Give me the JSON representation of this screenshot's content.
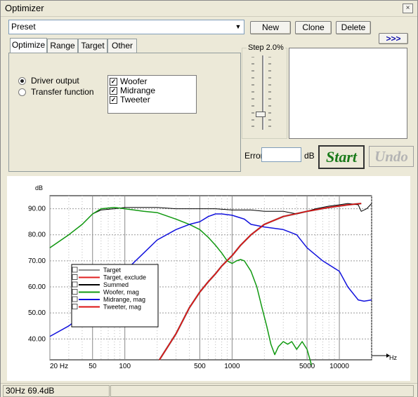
{
  "window": {
    "title": "Optimizer",
    "close_label": "×"
  },
  "preset": {
    "value": "Preset"
  },
  "buttons": {
    "new": "New",
    "clone": "Clone",
    "delete": "Delete",
    "more": ">>>"
  },
  "tabs": [
    {
      "label": "Optimize",
      "active": true
    },
    {
      "label": "Range",
      "active": false
    },
    {
      "label": "Target",
      "active": false
    },
    {
      "label": "Other",
      "active": false
    }
  ],
  "radios": [
    {
      "label": "Driver output",
      "selected": true
    },
    {
      "label": "Transfer function",
      "selected": false
    }
  ],
  "drivers": [
    {
      "label": "Woofer",
      "checked": true
    },
    {
      "label": "Midrange",
      "checked": true
    },
    {
      "label": "Tweeter",
      "checked": true
    }
  ],
  "step": {
    "label": "Step 2.0%"
  },
  "error": {
    "label": "Error",
    "value": "",
    "unit": "dB"
  },
  "actions": {
    "start": "Start",
    "undo": "Undo"
  },
  "status": {
    "cursor": "30Hz 69.4dB"
  },
  "colors": {
    "target": "#8c8c8c",
    "target_exclude": "#e02020",
    "summed": "#000000",
    "woofer": "#119911",
    "midrange": "#1111dd",
    "tweeter": "#dd1111",
    "start_text": "#1a7a1a",
    "undo_text": "#b4b4b4"
  },
  "chart_data": {
    "type": "line",
    "ylabel": "dB",
    "xlabel": "Hz",
    "x_scale": "log",
    "xlim": [
      20,
      20000
    ],
    "ylim": [
      32,
      95
    ],
    "x_ticks": [
      {
        "value": 20,
        "label": "20 Hz"
      },
      {
        "value": 50,
        "label": "50"
      },
      {
        "value": 100,
        "label": "100"
      },
      {
        "value": 500,
        "label": "500"
      },
      {
        "value": 1000,
        "label": "1000"
      },
      {
        "value": 5000,
        "label": "5000"
      },
      {
        "value": 10000,
        "label": "10000"
      }
    ],
    "y_ticks": [
      {
        "value": 90,
        "label": "90.00"
      },
      {
        "value": 80,
        "label": "80.00"
      },
      {
        "value": 70,
        "label": "70.00"
      },
      {
        "value": 60,
        "label": "60.00"
      },
      {
        "value": 50,
        "label": "50.00"
      },
      {
        "value": 40,
        "label": "40.00"
      }
    ],
    "legend_position": "center-left",
    "series": [
      {
        "name": "Target",
        "color": "#8c8c8c",
        "width": 2.5,
        "points": [
          [
            210,
            32
          ],
          [
            300,
            42
          ],
          [
            400,
            52
          ],
          [
            500,
            58
          ],
          [
            600,
            62
          ],
          [
            700,
            65
          ],
          [
            800,
            68
          ],
          [
            1000,
            72
          ],
          [
            1200,
            76
          ],
          [
            1500,
            80
          ],
          [
            2000,
            84
          ],
          [
            3000,
            87
          ],
          [
            5000,
            89
          ],
          [
            8000,
            90.5
          ],
          [
            12000,
            91.5
          ],
          [
            16000,
            92
          ]
        ]
      },
      {
        "name": "Target, exclude",
        "color": "#e02020",
        "width": 1.5,
        "points": [
          [
            210,
            32
          ],
          [
            300,
            42
          ],
          [
            400,
            52
          ],
          [
            500,
            58
          ],
          [
            600,
            62
          ],
          [
            700,
            65
          ],
          [
            800,
            68
          ],
          [
            1000,
            72
          ],
          [
            1200,
            76
          ],
          [
            1500,
            80
          ],
          [
            2000,
            84
          ],
          [
            3000,
            87
          ],
          [
            5000,
            89
          ],
          [
            8000,
            90.5
          ],
          [
            12000,
            91.5
          ],
          [
            16000,
            92
          ]
        ]
      },
      {
        "name": "Summed",
        "color": "#000000",
        "width": 1,
        "points": [
          [
            20,
            75
          ],
          [
            30,
            80
          ],
          [
            40,
            84
          ],
          [
            50,
            88
          ],
          [
            60,
            89.5
          ],
          [
            80,
            90
          ],
          [
            100,
            90.5
          ],
          [
            150,
            90.5
          ],
          [
            200,
            90.5
          ],
          [
            300,
            90
          ],
          [
            400,
            90
          ],
          [
            500,
            90
          ],
          [
            700,
            90
          ],
          [
            1000,
            89.5
          ],
          [
            1500,
            89.5
          ],
          [
            2000,
            89
          ],
          [
            3000,
            89
          ],
          [
            4000,
            88
          ],
          [
            5000,
            89
          ],
          [
            6000,
            90
          ],
          [
            8000,
            91
          ],
          [
            10000,
            91.5
          ],
          [
            12000,
            92
          ],
          [
            15000,
            91.5
          ],
          [
            16000,
            89
          ],
          [
            18000,
            90
          ],
          [
            20000,
            92
          ]
        ]
      },
      {
        "name": "Woofer, mag",
        "color": "#119911",
        "width": 1.5,
        "points": [
          [
            20,
            75
          ],
          [
            30,
            80
          ],
          [
            40,
            84
          ],
          [
            50,
            88
          ],
          [
            60,
            90
          ],
          [
            80,
            90.5
          ],
          [
            100,
            90
          ],
          [
            150,
            89
          ],
          [
            200,
            88.5
          ],
          [
            300,
            86
          ],
          [
            400,
            84
          ],
          [
            500,
            82
          ],
          [
            600,
            79
          ],
          [
            700,
            76
          ],
          [
            800,
            73
          ],
          [
            900,
            70
          ],
          [
            1000,
            69
          ],
          [
            1100,
            70
          ],
          [
            1200,
            70.5
          ],
          [
            1300,
            70
          ],
          [
            1500,
            66
          ],
          [
            1700,
            60
          ],
          [
            1900,
            52
          ],
          [
            2100,
            45
          ],
          [
            2300,
            38
          ],
          [
            2500,
            34
          ],
          [
            2700,
            37
          ],
          [
            3000,
            39
          ],
          [
            3300,
            38
          ],
          [
            3600,
            39
          ],
          [
            4000,
            36
          ],
          [
            4500,
            39
          ],
          [
            5000,
            36
          ],
          [
            5500,
            30
          ]
        ]
      },
      {
        "name": "Midrange, mag",
        "color": "#1111dd",
        "width": 1.5,
        "points": [
          [
            20,
            41
          ],
          [
            30,
            45
          ],
          [
            40,
            49
          ],
          [
            50,
            53
          ],
          [
            70,
            60
          ],
          [
            100,
            66
          ],
          [
            150,
            73
          ],
          [
            200,
            78
          ],
          [
            300,
            82
          ],
          [
            400,
            84
          ],
          [
            500,
            85
          ],
          [
            600,
            87
          ],
          [
            700,
            88
          ],
          [
            800,
            88
          ],
          [
            1000,
            87.5
          ],
          [
            1300,
            86
          ],
          [
            1500,
            84
          ],
          [
            2000,
            83
          ],
          [
            3000,
            82
          ],
          [
            4000,
            80
          ],
          [
            5000,
            75
          ],
          [
            7000,
            70
          ],
          [
            10000,
            66
          ],
          [
            12000,
            60
          ],
          [
            15000,
            55
          ],
          [
            17000,
            54.5
          ],
          [
            20000,
            55
          ]
        ]
      },
      {
        "name": "Tweeter, mag",
        "color": "#dd1111",
        "width": 1.5,
        "points": [
          [
            210,
            32
          ],
          [
            300,
            42
          ],
          [
            400,
            52
          ],
          [
            500,
            58
          ],
          [
            600,
            62
          ],
          [
            700,
            65
          ],
          [
            800,
            68
          ],
          [
            1000,
            72
          ],
          [
            1200,
            76
          ],
          [
            1500,
            80
          ],
          [
            2000,
            84
          ],
          [
            3000,
            87
          ],
          [
            5000,
            89
          ],
          [
            8000,
            90.5
          ],
          [
            12000,
            91.5
          ],
          [
            16000,
            92
          ]
        ]
      }
    ]
  }
}
